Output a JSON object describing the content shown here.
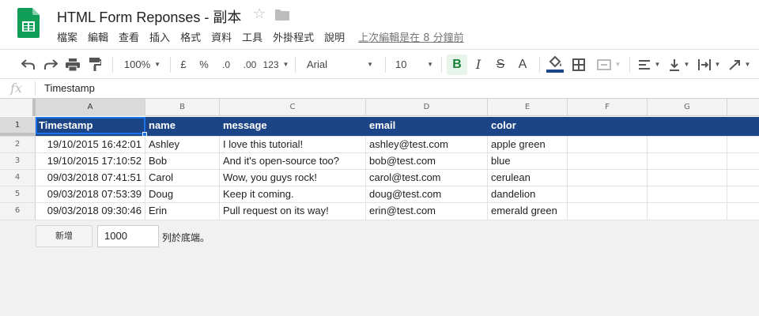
{
  "header": {
    "title": "HTML Form Reponses - 副本",
    "star_icon": "☆",
    "menu": [
      "檔案",
      "編輯",
      "查看",
      "插入",
      "格式",
      "資料",
      "工具",
      "外掛程式",
      "說明"
    ],
    "last_edit": "上次編輯是在 8 分鐘前"
  },
  "toolbar": {
    "zoom": "100%",
    "currency": "£",
    "percent": "%",
    "dec_decrease": ".0",
    "dec_increase": ".00",
    "more_formats": "123",
    "font": "Arial",
    "font_size": "10",
    "bold": "B",
    "italic": "I",
    "strike": "S",
    "text_color": "A",
    "accent_color": "#188038",
    "fill_color": "#1c4587"
  },
  "formula_bar": {
    "fx": "fx",
    "value": "Timestamp"
  },
  "grid": {
    "columns": [
      "A",
      "B",
      "C",
      "D",
      "E",
      "F",
      "G"
    ],
    "row_numbers": [
      "1",
      "2",
      "3",
      "4",
      "5",
      "6"
    ],
    "header": [
      "Timestamp",
      "name",
      "message",
      "email",
      "color"
    ],
    "rows": [
      [
        "19/10/2015 16:42:01",
        "Ashley",
        "I love this tutorial!",
        "ashley@test.com",
        "apple green"
      ],
      [
        "19/10/2015 17:10:52",
        "Bob",
        "And it's open-source too?",
        "bob@test.com",
        "blue"
      ],
      [
        "09/03/2018 07:41:51",
        "Carol",
        "Wow, you guys rock!",
        "carol@test.com",
        "cerulean"
      ],
      [
        "09/03/2018 07:53:39",
        "Doug",
        "Keep it coming.",
        "doug@test.com",
        "dandelion"
      ],
      [
        "09/03/2018 09:30:46",
        "Erin",
        "Pull request on its way!",
        "erin@test.com",
        "emerald green"
      ]
    ]
  },
  "footer": {
    "add_button": "新增",
    "rows_value": "1000",
    "rows_suffix": "列於底端。"
  }
}
